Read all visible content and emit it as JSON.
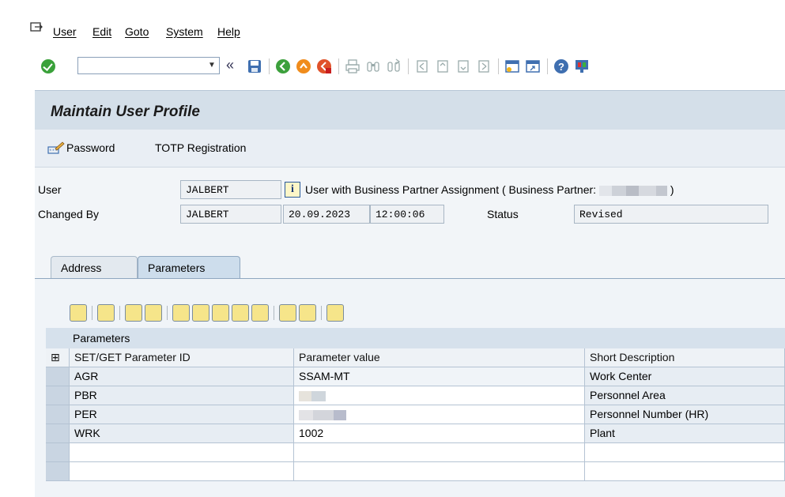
{
  "menu": {
    "items": [
      {
        "label": "User"
      },
      {
        "label": "Edit"
      },
      {
        "label": "Goto"
      },
      {
        "label": "System"
      },
      {
        "label": "Help"
      }
    ]
  },
  "toolbar": {
    "command_field_value": "",
    "back_label": "«"
  },
  "screen": {
    "title": "Maintain User Profile",
    "app_buttons": {
      "password": "Password",
      "totp": "TOTP Registration"
    }
  },
  "form": {
    "user_label": "User",
    "user_value": "JALBERT",
    "bp_text_prefix": "User with Business Partner Assignment ( Business Partner:",
    "bp_text_suffix": ")",
    "changed_by_label": "Changed By",
    "changed_by_value": "JALBERT",
    "changed_date": "20.09.2023",
    "changed_time": "12:00:06",
    "status_label": "Status",
    "status_value": "Revised"
  },
  "tabs": [
    {
      "label": "Address",
      "active": false
    },
    {
      "label": "Parameters",
      "active": true
    }
  ],
  "grid": {
    "title": "Parameters",
    "columns": [
      "SET/GET Parameter ID",
      "Parameter value",
      "Short Description"
    ],
    "rows": [
      {
        "id": "AGR",
        "value": "SSAM-MT",
        "desc": "Work Center"
      },
      {
        "id": "PBR",
        "value": "",
        "desc": "Personnel Area"
      },
      {
        "id": "PER",
        "value": "",
        "desc": "Personnel Number (HR)"
      },
      {
        "id": "WRK",
        "value": "1002",
        "desc": "Plant"
      }
    ]
  },
  "colors": {
    "ok_green": "#3aa13a",
    "title_bar": "#d4dfe9",
    "tab_active": "#cdddec",
    "redaction": "#c8ccd4"
  },
  "icons": [
    "enter-icon",
    "save-icon",
    "back-icon",
    "exit-icon",
    "cancel-icon",
    "print-icon",
    "find-icon",
    "find-next-icon",
    "first-page-icon",
    "previous-page-icon",
    "next-page-icon",
    "last-page-icon",
    "create-session-icon",
    "shortcut-icon",
    "help-icon",
    "customize-layout-icon"
  ]
}
